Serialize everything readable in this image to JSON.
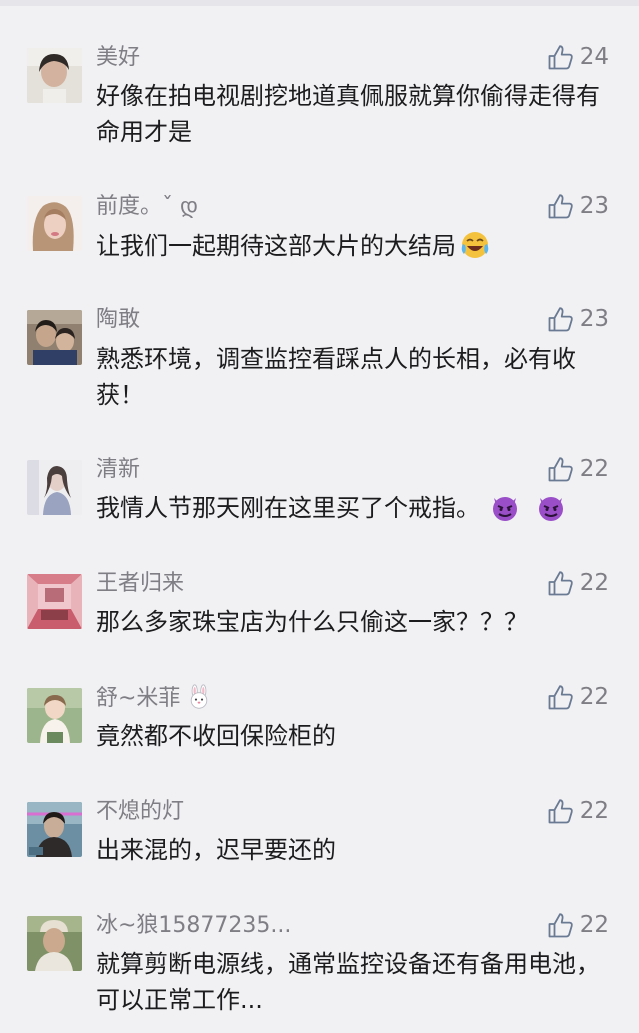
{
  "comments": [
    {
      "user": "美好",
      "likes": "24",
      "text": "好像在拍电视剧挖地道真佩服就算你偷得走得有命用才是",
      "avatar_colors": [
        "#dfdfd8",
        "#3a3330",
        "#d8b8a2"
      ]
    },
    {
      "user": "前度。ˇ დ",
      "likes": "23",
      "text": "让我们一起期待这部大片的大结局",
      "emoji_name": "crying-laughing-emoji",
      "avatar_colors": [
        "#f3ece8",
        "#b58f72",
        "#e7c2b2"
      ]
    },
    {
      "user": "陶敢",
      "likes": "23",
      "text": "熟悉环境，调查监控看踩点人的长相，必有收获！",
      "avatar_colors": [
        "#8a7c6c",
        "#2b2421",
        "#c4a58c"
      ]
    },
    {
      "user": "清新",
      "likes": "22",
      "text": "我情人节那天刚在这里买了个戒指。",
      "emoji_name": "devil-emoji",
      "avatar_colors": [
        "#ececf0",
        "#8b93ad",
        "#dfcdc6"
      ]
    },
    {
      "user": "王者归来",
      "likes": "22",
      "text": "那么多家珠宝店为什么只偷这一家？？？",
      "avatar_colors": [
        "#d96d7c",
        "#e7b1b8",
        "#7a3c44"
      ]
    },
    {
      "user": "舒~米菲",
      "likes": "22",
      "text": "竟然都不收回保险柜的",
      "emoji_name": "rabbit-emoji",
      "avatar_colors": [
        "#a3b992",
        "#f4efe7",
        "#6f8c5f"
      ]
    },
    {
      "user": "不熄的灯",
      "likes": "22",
      "text": "出来混的，迟早要还的",
      "avatar_colors": [
        "#5f8296",
        "#2a2624",
        "#c9b3a0"
      ]
    },
    {
      "user": "冰~狼15877235...",
      "likes": "22",
      "text": "就算剪断电源线，通常监控设备还有备用电池，可以正常工作...",
      "avatar_colors": [
        "#7d8f62",
        "#e7e0d5",
        "#c8a98f"
      ]
    }
  ],
  "colors": {
    "background": "#f1f1f4",
    "meta_text": "#7e7e84",
    "body_text": "#1c1c1e",
    "like_icon": "#6a7a92"
  }
}
